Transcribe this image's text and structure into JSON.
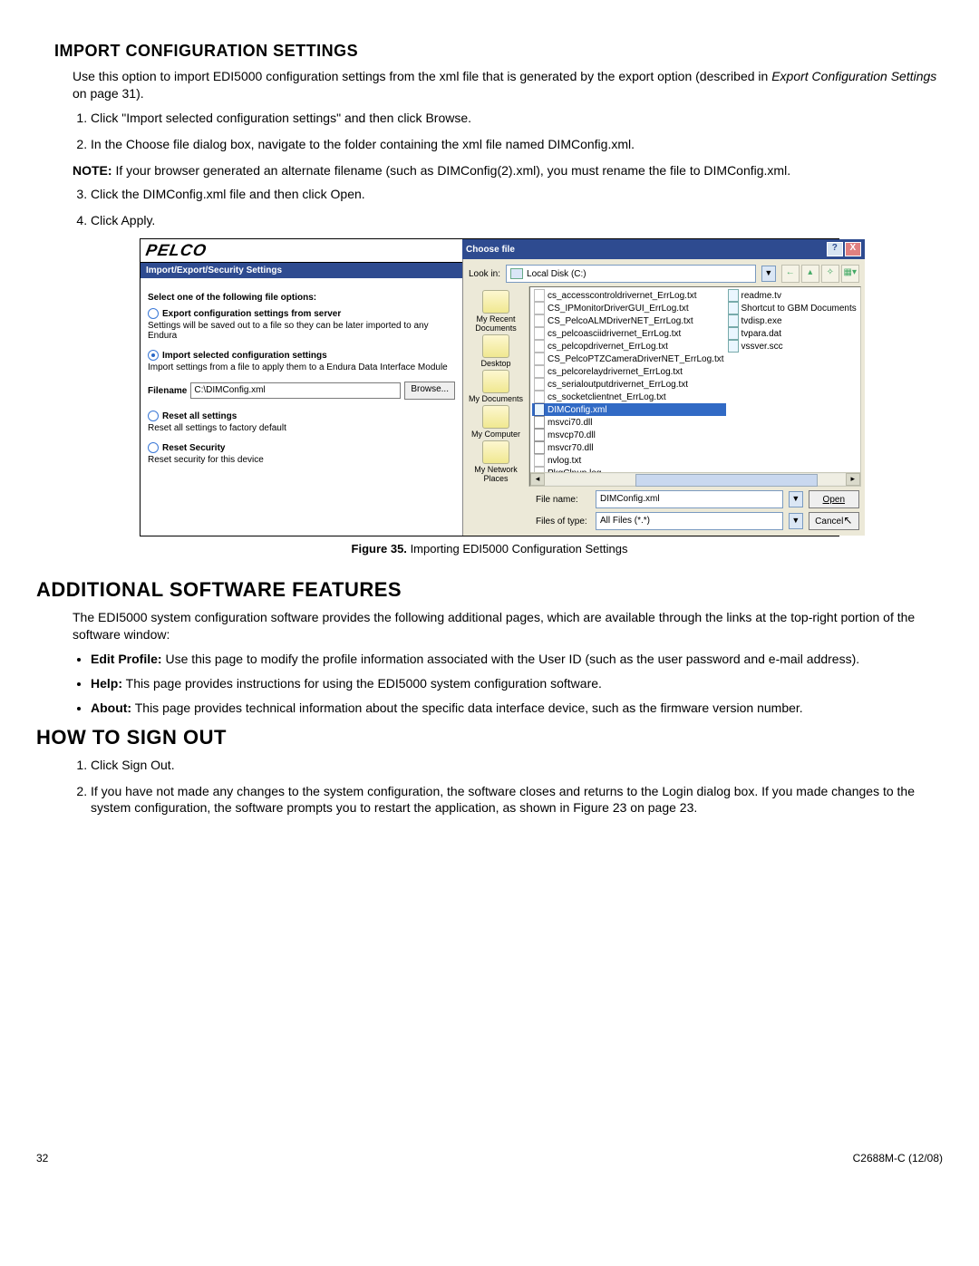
{
  "section1": {
    "title": "Import Configuration Settings",
    "intro1": "Use this option to import EDI5000 configuration settings from the xml file that is generated by the export option (described in ",
    "introItalic": "Export Configuration Settings",
    "intro2": " on page 31).",
    "steps": [
      "Click \"Import selected configuration settings\" and then click Browse.",
      "In the Choose file dialog box, navigate to the folder containing the xml file named DIMConfig.xml."
    ],
    "noteLabel": "NOTE:",
    "noteText": "If your browser generated an alternate filename (such as DIMConfig(2).xml), you must rename the file to DIMConfig.xml.",
    "steps2": [
      "Click the DIMConfig.xml file and then click Open.",
      "Click Apply."
    ]
  },
  "screenshot": {
    "left": {
      "brand": "PELCO",
      "band": "Import/Export/Security Settings",
      "optTitle": "Select one of the following file options:",
      "opt1Label": "Export configuration settings from server",
      "opt1Sub": "Settings will be saved out to a file so they can be later imported to any Endura",
      "opt2Label": "Import selected configuration settings",
      "opt2Sub": "Import settings from a file to apply them to a Endura Data Interface Module",
      "filenameLabel": "Filename",
      "filenameValue": "C:\\DIMConfig.xml",
      "browse": "Browse...",
      "opt3Label": "Reset all settings",
      "opt3Sub": "Reset all settings to factory default",
      "opt4Label": "Reset Security",
      "opt4Sub": "Reset security for this device"
    },
    "dialog": {
      "title": "Choose file",
      "help": "?",
      "close": "X",
      "lookinLabel": "Look in:",
      "lookinValue": "Local Disk (C:)",
      "places": [
        "My Recent Documents",
        "Desktop",
        "My Documents",
        "My Computer",
        "My Network Places"
      ],
      "col1": [
        "cs_accesscontroldrivernet_ErrLog.txt",
        "CS_IPMonitorDriverGUI_ErrLog.txt",
        "CS_PelcoALMDriverNET_ErrLog.txt",
        "cs_pelcoasciidrivernet_ErrLog.txt",
        "cs_pelcopdrivernet_ErrLog.txt",
        "CS_PelcoPTZCameraDriverNET_ErrLog.txt",
        "cs_pelcorelaydrivernet_ErrLog.txt",
        "cs_serialoutputdrivernet_ErrLog.txt",
        "cs_socketclientnet_ErrLog.txt",
        "DIMConfig.xml",
        "msvci70.dll",
        "msvcp70.dll",
        "msvcr70.dll",
        "nvlog.txt",
        "PkgClnup.log"
      ],
      "col2": [
        "readme.tv",
        "Shortcut to GBM Documents",
        "tvdisp.exe",
        "tvpara.dat",
        "vssver.scc"
      ],
      "filenameLabel": "File name:",
      "filenameValue": "DIMConfig.xml",
      "filetypeLabel": "Files of type:",
      "filetypeValue": "All Files (*.*)",
      "open": "Open",
      "cancel": "Cancel"
    }
  },
  "figure": {
    "label": "Figure 35.",
    "text": "Importing EDI5000 Configuration Settings"
  },
  "section2": {
    "title": "Additional Software Features",
    "intro": "The EDI5000 system configuration software provides the following additional pages, which are available through the links at the top-right portion of the software window:",
    "bullets": [
      {
        "b": "Edit Profile:",
        "t": " Use this page to modify the profile information associated with the User ID (such as the user password and e-mail address)."
      },
      {
        "b": "Help:",
        "t": " This page provides instructions for using the EDI5000 system configuration software."
      },
      {
        "b": "About:",
        "t": " This page provides technical information about the specific data interface device, such as the firmware version number."
      }
    ]
  },
  "section3": {
    "title": "How To Sign Out",
    "steps": [
      "Click Sign Out.",
      "If you have not made any changes to the system configuration, the software closes and returns to the Login dialog box.  If you made changes to the system configuration, the software prompts you to restart the application, as shown in Figure 23 on page 23."
    ]
  },
  "footer": {
    "page": "32",
    "doc": "C2688M-C (12/08)"
  }
}
